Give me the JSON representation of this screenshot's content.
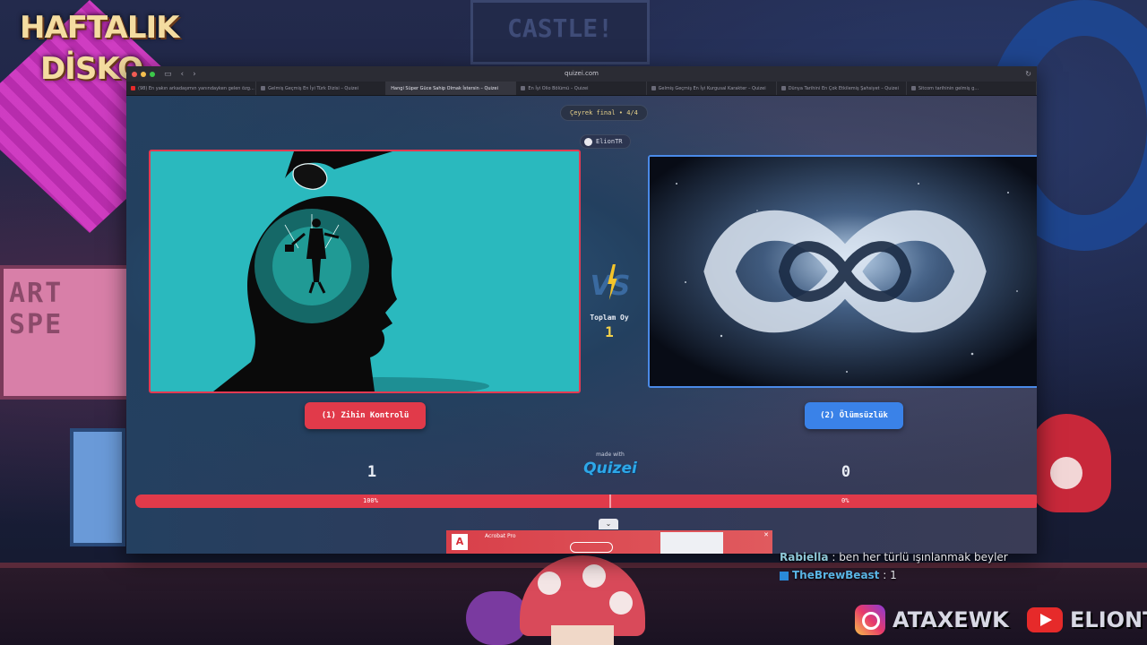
{
  "overlay": {
    "brand_line1": "HAFTALIK",
    "brand_line2": "DİSKO",
    "castle_sign": "CASTLE!",
    "sign_text": "ART SPE",
    "chat": [
      {
        "user": "Rabiella",
        "message": " : ben her türlü ışınlanmak beyler"
      },
      {
        "user": "TheBrewBeast",
        "message": " : 1"
      }
    ],
    "instagram": {
      "icon": "instagram-icon",
      "handle": "ATAXEWK"
    },
    "youtube": {
      "icon": "youtube-icon",
      "handle": "ELIONTR"
    }
  },
  "browser": {
    "url": "quizei.com",
    "tabs": [
      {
        "label": "(98) En yakın arkadaşımın yanındayken gelen özg…",
        "icon": "youtube-icon",
        "active": false
      },
      {
        "label": "Gelmiş Geçmiş En İyi Türk Dizisi – Quizei",
        "active": false
      },
      {
        "label": "Hangi Süper Güce Sahip Olmak İstersin – Quizei",
        "active": true
      },
      {
        "label": "En İyi Olio Bölümü – Quizei",
        "active": false
      },
      {
        "label": "Gelmiş Geçmiş En İyi Kurgusal Karakter – Quizei",
        "active": false
      },
      {
        "label": "Dünya Tarihini En Çok Etkilemiş Şahsiyet – Quizei",
        "active": false
      },
      {
        "label": "Sitcom tarihinin gelmiş g…",
        "active": false
      }
    ]
  },
  "quiz": {
    "round": "Çeyrek final • 4/4",
    "username": "ElionTR",
    "vs_label": "VS",
    "total_votes_label": "Toplam Oy",
    "total_votes": "1",
    "left_choice": "(1) Zihin Kontrolü",
    "right_choice": "(2) Ölümsüzlük",
    "left_votes": "1",
    "right_votes": "0",
    "made_with": "made with",
    "brand": "Quizei",
    "left_percent_label": "100%",
    "right_percent_label": "0%",
    "left_percent": 100,
    "right_percent": 0,
    "colors": {
      "left": "#e13a4a",
      "right": "#3a82e8",
      "accent": "#f4d24a"
    }
  },
  "ad": {
    "title": "Acrobat Pro",
    "logo_text": "A"
  }
}
